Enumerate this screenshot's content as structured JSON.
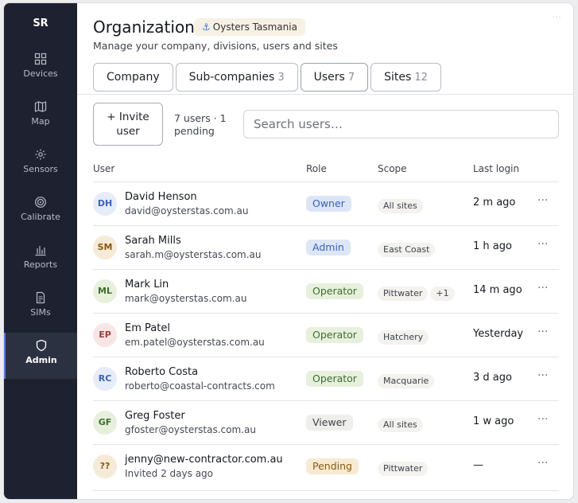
{
  "sidebar": {
    "initials": "SR",
    "items": [
      {
        "label": "Devices",
        "icon": "grid-icon",
        "active": false
      },
      {
        "label": "Map",
        "icon": "map-icon",
        "active": false
      },
      {
        "label": "Sensors",
        "icon": "sensor-icon",
        "active": false
      },
      {
        "label": "Calibrate",
        "icon": "target-icon",
        "active": false
      },
      {
        "label": "Reports",
        "icon": "bar-chart-icon",
        "active": false
      },
      {
        "label": "SIMs",
        "icon": "sim-card-icon",
        "active": false
      },
      {
        "label": "Admin",
        "icon": "shield-icon",
        "active": true
      }
    ]
  },
  "header": {
    "title": "Organization",
    "org_badge": "Oysters Tasmania",
    "subtitle": "Manage your company, divisions, users and sites"
  },
  "tabs": [
    {
      "label": "Company",
      "count": ""
    },
    {
      "label": "Sub-companies",
      "count": "3"
    },
    {
      "label": "Users",
      "count": "7"
    },
    {
      "label": "Sites",
      "count": "12"
    }
  ],
  "toolbar": {
    "invite_line1": "+ Invite",
    "invite_line2": "user",
    "count_line1": "7 users · 1",
    "count_line2": "pending",
    "search_placeholder": "Search users…"
  },
  "table": {
    "headers": {
      "user": "User",
      "role": "Role",
      "scope": "Scope",
      "last_login": "Last login"
    },
    "rows": [
      {
        "initials": "DH",
        "name": "David Henson",
        "email": "david@oysterstas.com.au",
        "role": "Owner",
        "scope": [
          "All sites"
        ],
        "last_login": "2 m ago"
      },
      {
        "initials": "SM",
        "name": "Sarah Mills",
        "email": "sarah.m@oysterstas.com.au",
        "role": "Admin",
        "scope": [
          "East Coast"
        ],
        "last_login": "1 h ago"
      },
      {
        "initials": "ML",
        "name": "Mark Lin",
        "email": "mark@oysterstas.com.au",
        "role": "Operator",
        "scope": [
          "Pittwater",
          "+1"
        ],
        "last_login": "14 m ago"
      },
      {
        "initials": "EP",
        "name": "Em Patel",
        "email": "em.patel@oysterstas.com.au",
        "role": "Operator",
        "scope": [
          "Hatchery"
        ],
        "last_login": "Yesterday"
      },
      {
        "initials": "RC",
        "name": "Roberto Costa",
        "email": "roberto@coastal-contracts.com",
        "role": "Operator",
        "scope": [
          "Macquarie"
        ],
        "last_login": "3 d ago"
      },
      {
        "initials": "GF",
        "name": "Greg Foster",
        "email": "gfoster@oysterstas.com.au",
        "role": "Viewer",
        "scope": [
          "All sites"
        ],
        "last_login": "1 w ago"
      },
      {
        "initials": "??",
        "name": "jenny@new-contractor.com.au",
        "email": "Invited 2 days ago",
        "role": "Pending",
        "scope": [
          "Pittwater"
        ],
        "last_login": "—"
      }
    ]
  },
  "colors": {
    "sidebar_bg": "#1e2230",
    "role_owner": "#dde6f7",
    "role_admin": "#dde6f7",
    "role_operator": "#e6f0dd",
    "role_viewer": "#eeeeea",
    "role_pending": "#f6ead2"
  }
}
